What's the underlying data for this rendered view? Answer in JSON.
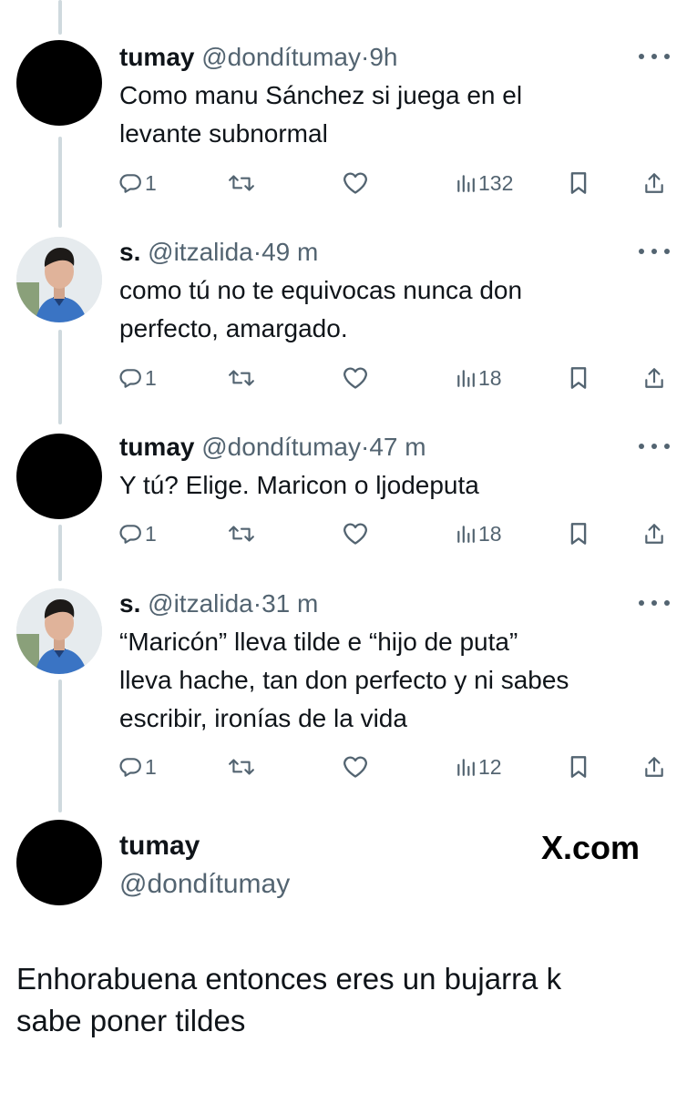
{
  "tweets": [
    {
      "name": "tumay",
      "handle": "@dondítumay",
      "separator": "·",
      "time": "9h",
      "avatar": "black-avatar",
      "lines": [
        "Como manu Sánchez si juega en el",
        "levante subnormal"
      ],
      "replies": "1",
      "views": "132"
    },
    {
      "name": "s.",
      "handle": "@itzalida",
      "separator": "·",
      "time": "49 m",
      "avatar": "player-photo-avatar",
      "lines": [
        "como tú no te equivocas nunca don",
        "perfecto, amargado."
      ],
      "replies": "1",
      "views": "18"
    },
    {
      "name": "tumay",
      "handle": "@dondítumay",
      "separator": "·",
      "time": "47 m",
      "avatar": "black-avatar",
      "lines": [
        "Y tú? Elige. Maricon o ljodeputa"
      ],
      "replies": "1",
      "views": "18"
    },
    {
      "name": "s.",
      "handle": "@itzalida",
      "separator": "·",
      "time": "31 m",
      "avatar": "player-photo-avatar",
      "lines": [
        "“Maricón” lleva tilde e “hijo de puta”",
        "lleva hache, tan don perfecto y ni sabes",
        "escribir, ironías de la vida"
      ],
      "replies": "1",
      "views": "12"
    }
  ],
  "final": {
    "name": "tumay",
    "handle": "@dondítumay",
    "brand": "X.com",
    "lines": [
      "Enhorabuena entonces eres un bujarra k",
      "sabe poner tildes"
    ]
  },
  "colors": {
    "text": "#0f1419",
    "secondary": "#536471",
    "thread_line": "#cfd9de",
    "background": "#ffffff"
  },
  "icons": [
    "reply-icon",
    "retweet-icon",
    "like-icon",
    "views-icon",
    "bookmark-icon",
    "share-icon",
    "more-options-icon"
  ]
}
